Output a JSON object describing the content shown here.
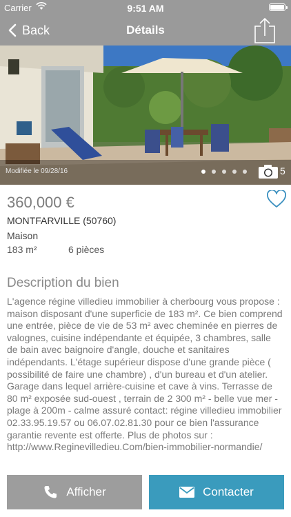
{
  "status_bar": {
    "carrier": "Carrier",
    "time": "9:51 AM"
  },
  "nav": {
    "back_label": "Back",
    "title": "Détails"
  },
  "gallery": {
    "modified_text": "Modifiée le 09/28/16",
    "photo_count": "5",
    "dots": 5,
    "active_dot": 0
  },
  "listing": {
    "price": "360,000 €",
    "city": "MONTFARVILLE (50760)",
    "property_type": "Maison",
    "surface": "183 m²",
    "rooms": "6 pièces"
  },
  "description": {
    "title": "Description du bien",
    "text": "L'agence régine villedieu immobilier à cherbourg vous propose : maison disposant d'une superficie de 183 m². Ce bien comprend une entrée, pièce de vie de 53 m² avec cheminée en pierres de valognes, cuisine indépendante et équipée, 3 chambres, salle de bain avec baignoire d'angle, douche et sanitaires indépendants. L'étage supérieur dispose d'une grande pièce ( possibilité de faire une chambre) , d'un bureau et d'un atelier. Garage dans lequel arrière-cuisine et cave à vins. Terrasse de 80 m² exposée sud-ouest , terrain de 2 300 m² - belle vue mer - plage à 200m - calme assuré contact: régine villedieu immobilier 02.33.95.19.57 ou 06.07.02.81.30 pour ce bien l'assurance garantie revente est offerte. Plus de photos sur : http://www.Reginevilledieu.Com/bien-immobilier-normandie/"
  },
  "actions": {
    "call_label": "Afficher",
    "contact_label": "Contacter"
  },
  "icons": {
    "back": "chevron-left-icon",
    "share": "share-icon",
    "camera": "camera-icon",
    "favorite": "heart-outline-icon",
    "phone": "phone-icon",
    "mail": "envelope-icon"
  },
  "colors": {
    "nav_bar": "#9a9a9a",
    "call_button": "#9d9d9d",
    "contact_button": "#3a9bbd",
    "favorite_icon": "#3a8fbf"
  }
}
